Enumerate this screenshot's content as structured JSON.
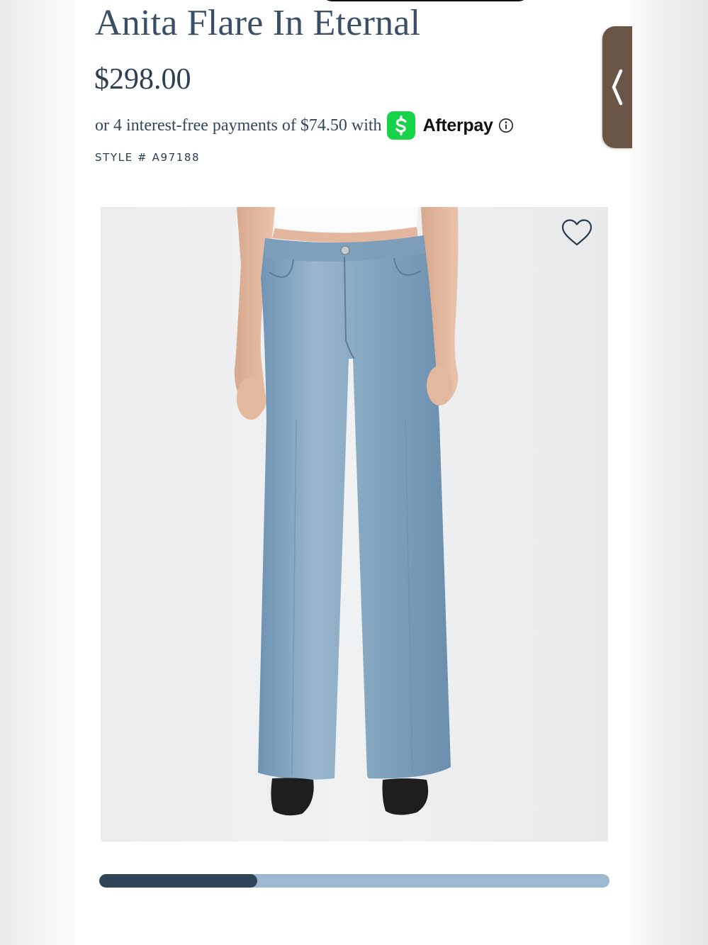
{
  "product": {
    "title": "Anita Flare In Eternal",
    "price": "$298.00",
    "installments_text": "or 4 interest-free payments of $74.50 with",
    "payment_provider": "Afterpay",
    "style_number": "STYLE # A97188"
  },
  "image": {
    "alt": "Light wash high-rise wide leg flare jeans worn with white crop top and black shoes"
  },
  "gallery": {
    "progress_fraction": 0.31
  },
  "icons": {
    "cashapp": "cash-app-icon",
    "info": "info-icon",
    "wishlist": "heart-icon",
    "side_tab": "chevron-left-icon"
  },
  "colors": {
    "title_text": "#3a4f66",
    "cashapp_green": "#16d34a",
    "progress_fill": "#2f4559",
    "progress_track": "#9db8d1",
    "side_tab": "#6a5646"
  }
}
